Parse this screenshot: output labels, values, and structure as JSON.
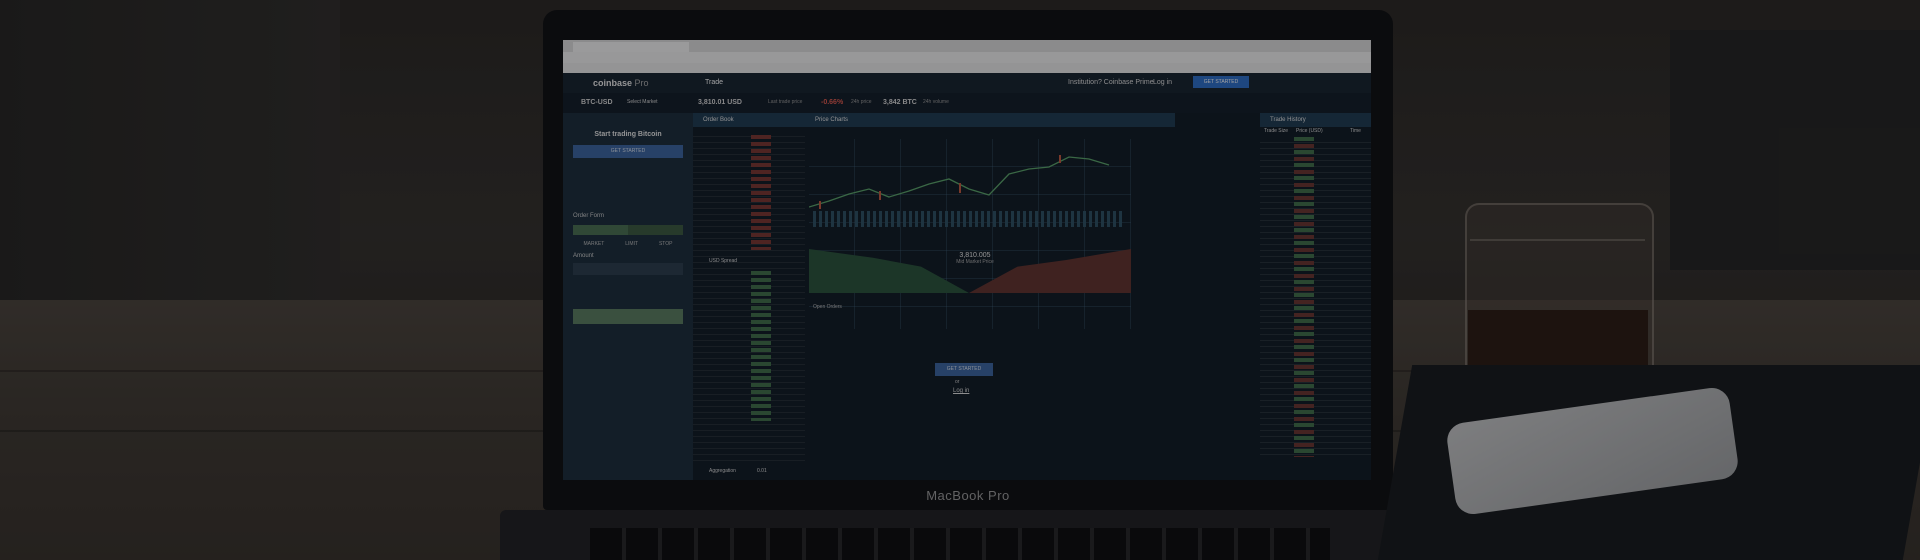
{
  "laptop": {
    "brand": "MacBook Pro"
  },
  "app": {
    "logo": "coinbase",
    "logo_suffix": "Pro",
    "nav_trade": "Trade",
    "institution_link": "Institution? Coinbase Prime",
    "login": "Log in",
    "get_started": "GET STARTED"
  },
  "market": {
    "pair": "BTC-USD",
    "select_market": "Select Market",
    "last_price": "3,810.01 USD",
    "last_price_label": "Last trade price",
    "change": "-0.66%",
    "change_label": "24h price",
    "volume": "3,842 BTC",
    "volume_label": "24h volume"
  },
  "left_panel": {
    "title": "Start trading Bitcoin",
    "cta": "GET STARTED",
    "order_form": "Order Form",
    "tabs": [
      "MARKET",
      "LIMIT",
      "STOP"
    ],
    "amount_label": "Amount"
  },
  "order_book": {
    "title": "Order Book",
    "spread_label": "USD Spread",
    "aggregation": "Aggregation",
    "aggregation_value": "0.01"
  },
  "chart_panel": {
    "title": "Price Charts",
    "mid_price": "3,810.005",
    "mid_label": "Mid Market Price",
    "open_orders": "Open Orders",
    "cta": "GET STARTED",
    "or": "or",
    "login": "Log in"
  },
  "trade_history": {
    "title": "Trade History",
    "col_size": "Trade Size",
    "col_price": "Price (USD)",
    "col_time": "Time"
  },
  "colors": {
    "panel_header": "#1e3b52",
    "buy": "#3f6e4a",
    "sell": "#7a3631",
    "accent": "#3b64a1"
  }
}
